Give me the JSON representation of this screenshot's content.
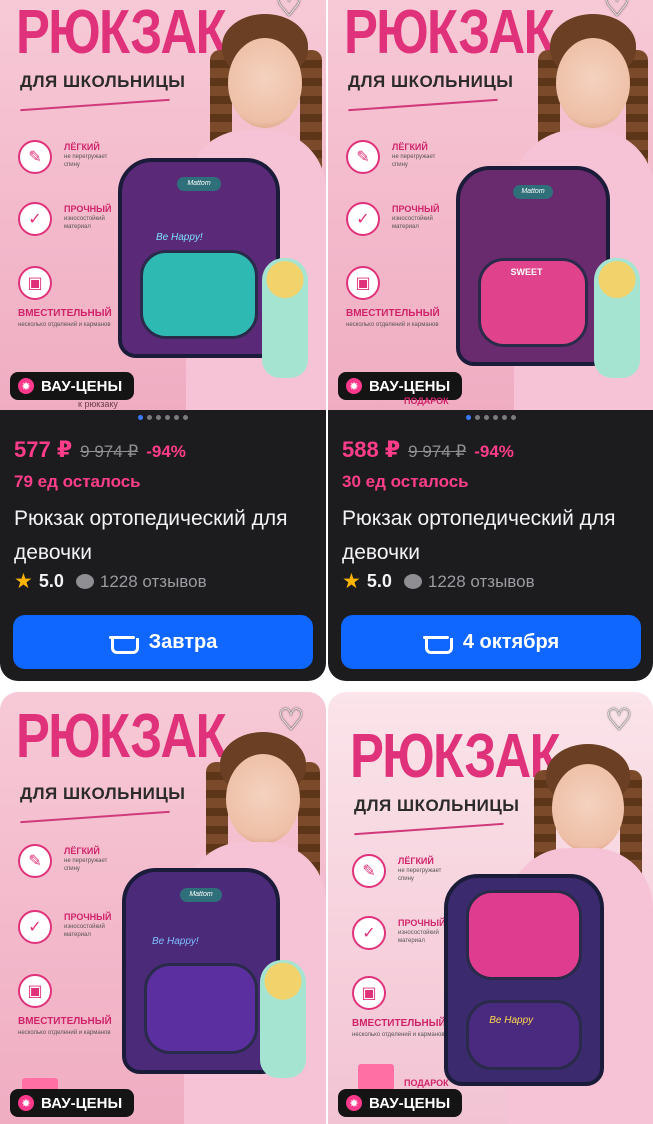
{
  "products": [
    {
      "heading": "РЮКЗАК",
      "subheading": "ДЛЯ ШКОЛЬНИЦЫ",
      "features": [
        {
          "title": "ЛЁГКИЙ",
          "desc": "не перегружает спину",
          "icon": "feather-icon"
        },
        {
          "title": "ПРОЧНЫЙ",
          "desc": "износостойкий материал",
          "icon": "shield-check-icon"
        },
        {
          "title": "ВМЕСТИТЕЛЬНЫЙ",
          "desc": "несколько отделений и карманов",
          "icon": "backpack-icon"
        }
      ],
      "backpack_logo": "Mattom",
      "backpack_text": "Be Happy!",
      "badge": "ВАУ-ЦЕНЫ",
      "photo_bottom_text": "к рюкзаку",
      "price": "577 ₽",
      "old_price": "9 974 ₽",
      "discount": "-94%",
      "stock": "79 ед осталось",
      "title": "Рюкзак ортопедический для девочки",
      "rating": "5.0",
      "reviews": "1228 отзывов",
      "delivery": "Завтра",
      "colors": {
        "pack": "#5a2a78",
        "pocket": "#2fb9b3"
      }
    },
    {
      "heading": "РЮКЗАК",
      "subheading": "ДЛЯ ШКОЛЬНИЦЫ",
      "features": [
        {
          "title": "ЛЁГКИЙ",
          "desc": "не перегружает спину",
          "icon": "feather-icon"
        },
        {
          "title": "ПРОЧНЫЙ",
          "desc": "износостойкий материал",
          "icon": "shield-check-icon"
        },
        {
          "title": "ВМЕСТИТЕЛЬНЫЙ",
          "desc": "несколько отделений и карманов",
          "icon": "backpack-icon"
        }
      ],
      "backpack_logo": "Mattom",
      "backpack_text": "SWEET",
      "badge": "ВАУ-ЦЕНЫ",
      "photo_bottom_text": "ПОДАРОК",
      "price": "588 ₽",
      "old_price": "9 974 ₽",
      "discount": "-94%",
      "stock": "30 ед осталось",
      "title": "Рюкзак ортопедический для девочки",
      "rating": "5.0",
      "reviews": "1228 отзывов",
      "delivery": "4 октября",
      "colors": {
        "pack": "#6a2a6e",
        "pocket": "#e0438c"
      }
    },
    {
      "heading": "РЮКЗАК",
      "subheading": "ДЛЯ ШКОЛЬНИЦЫ",
      "features": [
        {
          "title": "ЛЁГКИЙ",
          "desc": "не перегружает спину",
          "icon": "feather-icon"
        },
        {
          "title": "ПРОЧНЫЙ",
          "desc": "износостойкий материал",
          "icon": "shield-check-icon"
        },
        {
          "title": "ВМЕСТИТЕЛЬНЫЙ",
          "desc": "несколько отделений и карманов",
          "icon": "backpack-icon"
        }
      ],
      "backpack_logo": "Mattom",
      "backpack_text": "Be Happy!",
      "badge": "ВАУ-ЦЕНЫ",
      "colors": {
        "pack": "#4b2a7a",
        "pocket": "#5b2fa0"
      }
    },
    {
      "heading": "РЮКЗАК",
      "subheading": "ДЛЯ ШКОЛЬНИЦЫ",
      "features": [
        {
          "title": "ЛЁГКИЙ",
          "desc": "не перегружает спину",
          "icon": "feather-icon"
        },
        {
          "title": "ПРОЧНЫЙ",
          "desc": "износостойкий материал",
          "icon": "shield-check-icon"
        },
        {
          "title": "ВМЕСТИТЕЛЬНЫЙ",
          "desc": "несколько отделений и карманов",
          "icon": "backpack-icon"
        }
      ],
      "backpack_text": "Be Happy",
      "badge": "ВАУ-ЦЕНЫ",
      "photo_bottom_text": "ПОДАРОК",
      "colors": {
        "pack": "#3c2a6e",
        "pocket": "#e03c8f"
      }
    }
  ],
  "colors": {
    "accent": "#ff3d8a",
    "cta": "#0f67ff",
    "card_bg": "#1c1c1e",
    "rating_star": "#ffb400"
  }
}
